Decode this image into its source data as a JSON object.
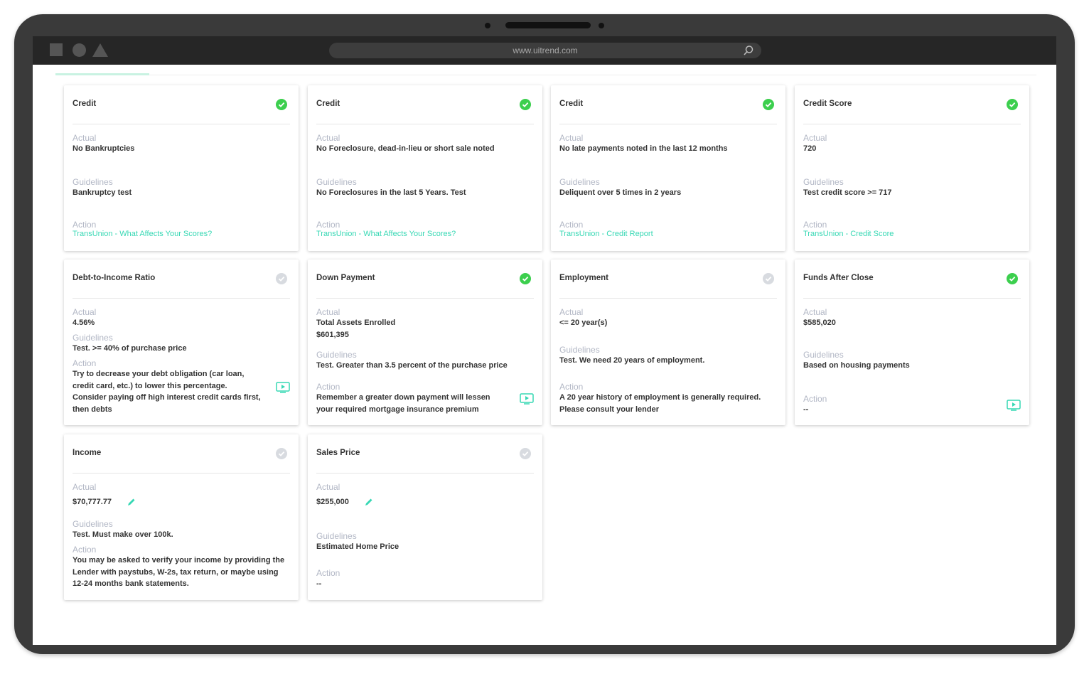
{
  "browser": {
    "url": "www.uitrend.com"
  },
  "colors": {
    "accent": "#37d8b4",
    "ok": "#3ccf4e",
    "pending": "#d8dbe0",
    "label": "#b2b7c5"
  },
  "labels": {
    "actual": "Actual",
    "guidelines": "Guidelines",
    "action": "Action"
  },
  "cards": [
    {
      "title": "Credit",
      "status": "ok",
      "actual": "No Bankruptcies",
      "guidelines": "Bankruptcy test",
      "action": "TransUnion - What Affects Your Scores?",
      "action_is_link": true
    },
    {
      "title": "Credit",
      "status": "ok",
      "actual": "No Foreclosure, dead-in-lieu or short sale noted",
      "guidelines": "No Foreclosures in the last 5 Years. Test",
      "action": "TransUnion - What Affects Your Scores?",
      "action_is_link": true
    },
    {
      "title": "Credit",
      "status": "ok",
      "actual": "No late payments noted in the last 12 months",
      "guidelines": "Deliquent over 5 times in 2 years",
      "action": "TransUnion - Credit Report",
      "action_is_link": true
    },
    {
      "title": "Credit Score",
      "status": "ok",
      "actual": "720",
      "guidelines": "Test credit score >= 717",
      "action": "TransUnion - Credit Score",
      "action_is_link": true
    },
    {
      "title": "Debt-to-Income Ratio",
      "status": "pending",
      "actual": "4.56%",
      "guidelines": "Test. >= 40% of purchase price",
      "action": "Try to decrease your debt obligation (car loan, credit card, etc.) to lower this percentage. Consider paying off high interest credit cards first, then debts",
      "has_video": true
    },
    {
      "title": "Down Payment",
      "status": "ok",
      "actual": "Total Assets Enrolled",
      "actual2": "$601,395",
      "guidelines": "Test. Greater than 3.5 percent of the purchase price",
      "action": "Remember a greater down payment will lessen your required mortgage insurance premium",
      "has_video": true
    },
    {
      "title": "Employment",
      "status": "pending",
      "actual": "<= 20 year(s)",
      "guidelines": "Test. We need 20 years of employment.",
      "action": "A 20 year history of employment is generally required. Please consult your lender"
    },
    {
      "title": "Funds After Close",
      "status": "ok",
      "actual": "$585,020",
      "guidelines": "Based on housing payments",
      "action": "--",
      "has_video": true
    },
    {
      "title": "Income",
      "status": "pending",
      "actual": "$70,777.77",
      "guidelines": "Test. Must make over 100k.",
      "action": "You may be asked to verify your income by providing the Lender with paystubs, W-2s, tax return, or maybe using 12-24 months bank statements.",
      "editable": true
    },
    {
      "title": "Sales Price",
      "status": "pending",
      "actual": "$255,000",
      "guidelines": "Estimated Home Price",
      "action": "--",
      "editable": true
    }
  ]
}
